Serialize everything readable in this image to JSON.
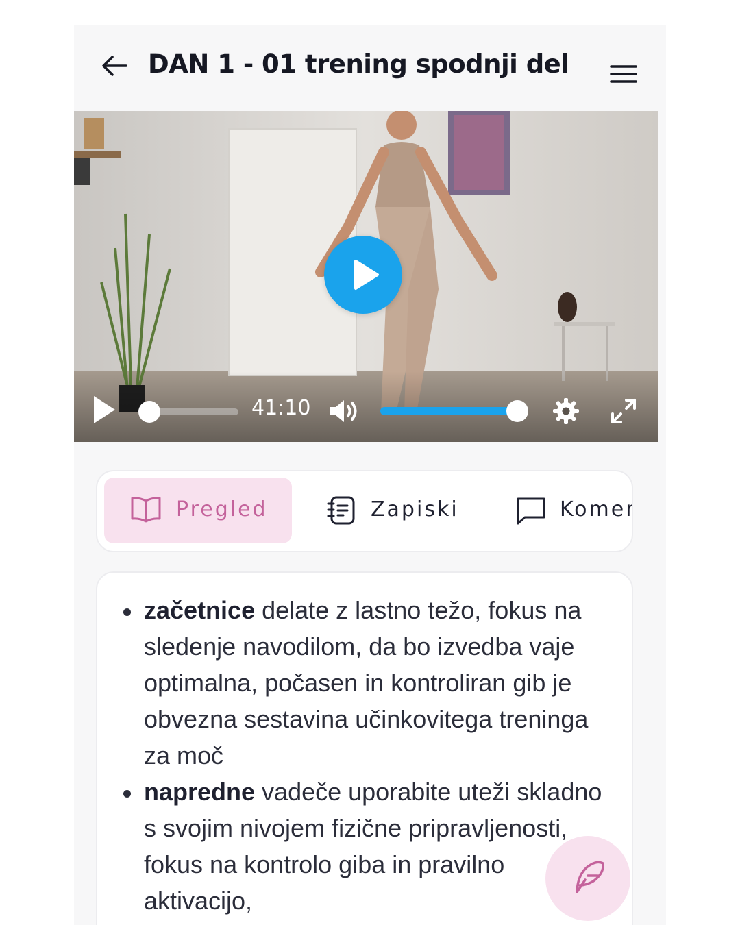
{
  "header": {
    "title": "DAN 1 - 01 trening spodnji del"
  },
  "video": {
    "time": "41:10",
    "progress": 0.0,
    "volume": 1.0
  },
  "tabs": [
    {
      "label": "Pregled",
      "icon": "book-icon",
      "active": true
    },
    {
      "label": "Zapiski",
      "icon": "notes-icon",
      "active": false
    },
    {
      "label": "Komentarji",
      "icon": "comment-icon",
      "active": false
    }
  ],
  "content": {
    "items": [
      {
        "bold": "začetnice",
        "text": " delate z lastno težo, fokus na sledenje navodilom, da bo izvedba vaje optimalna, počasen in kontroliran gib je obvezna sestavina učinkovitega treninga za moč"
      },
      {
        "bold": "napredne",
        "text": " vadeče uporabite uteži skladno s svojim nivojem fizične pripravljenosti, fokus na kontrolo giba in pravilno aktivacijo,"
      }
    ]
  },
  "colors": {
    "accent": "#1aa3ec",
    "active_tab_bg": "#f8e1ee",
    "active_tab_text": "#c4629b"
  },
  "fab": {
    "icon": "feather-icon"
  }
}
